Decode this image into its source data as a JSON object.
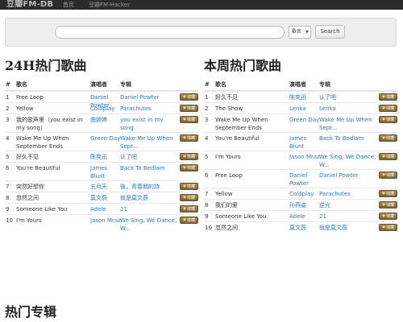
{
  "nav": {
    "brand": "豆瓣FM-DB",
    "links": [
      "首页",
      "豆瓣FM-Hacker"
    ]
  },
  "search": {
    "placeholder": "",
    "select_value": "歌名",
    "button_label": "Search"
  },
  "charts": [
    {
      "title": "24H热门歌曲",
      "headers": [
        "#",
        "歌名",
        "演唱者",
        "专辑"
      ],
      "rows": [
        {
          "num": "1",
          "song": "Free Loop",
          "artist": "Daniel Powter",
          "album": "Daniel Powter"
        },
        {
          "num": "2",
          "song": "Yellow",
          "artist": "Coldplay",
          "album": "Parachutes"
        },
        {
          "num": "3",
          "song": "我的歌声里（you exist in my song）",
          "artist": "曲婉婷",
          "album": "you exist in my song"
        },
        {
          "num": "4",
          "song": "Wake Me Up When September Ends",
          "artist": "Green Day",
          "album": "Wake Me Up When Sept..."
        },
        {
          "num": "5",
          "song": "好久不见",
          "artist": "陈奕迅",
          "album": "认了吧"
        },
        {
          "num": "6",
          "song": "You're Beautiful",
          "artist": "James Blunt",
          "album": "Back To Bedlam"
        },
        {
          "num": "7",
          "song": "突然好想你",
          "artist": "五月天",
          "album": "後。青春期的詩"
        },
        {
          "num": "8",
          "song": "忽然之间",
          "artist": "莫文蔚",
          "album": "就是莫文蔚"
        },
        {
          "num": "9",
          "song": "Someone Like You",
          "artist": "Adele",
          "album": "21"
        },
        {
          "num": "10",
          "song": "I'm Yours",
          "artist": "Jason Mraz",
          "album": "We Sing, We Dance, W..."
        }
      ]
    },
    {
      "title": "本周热门歌曲",
      "headers": [
        "#",
        "歌名",
        "演唱者",
        "专辑"
      ],
      "rows": [
        {
          "num": "1",
          "song": "好久不见",
          "artist": "陈奕迅",
          "album": "认了吧"
        },
        {
          "num": "2",
          "song": "The Show",
          "artist": "Lenka",
          "album": "Lenka"
        },
        {
          "num": "3",
          "song": "Wake Me Up When September Ends",
          "artist": "Green Day",
          "album": "Wake Me Up When Sept..."
        },
        {
          "num": "4",
          "song": "You're Beautiful",
          "artist": "James Blunt",
          "album": "Back To Bedlam"
        },
        {
          "num": "5",
          "song": "I'm Yours",
          "artist": "Jason Mraz",
          "album": "We Sing, We Dance, W..."
        },
        {
          "num": "6",
          "song": "Free Loop",
          "artist": "Daniel Powter",
          "album": "Daniel Powter"
        },
        {
          "num": "7",
          "song": "Yellow",
          "artist": "Coldplay",
          "album": "Parachutes"
        },
        {
          "num": "8",
          "song": "我们的爱",
          "artist": "孙燕姿",
          "album": "逆光"
        },
        {
          "num": "9",
          "song": "Someone Like You",
          "artist": "Adele",
          "album": "21"
        },
        {
          "num": "10",
          "song": "忽然之间",
          "artist": "莫文蔚",
          "album": "就是莫文蔚"
        }
      ]
    }
  ],
  "fav_label": "收藏",
  "albums_title": "热门专辑",
  "colors": {
    "link": "#2a7ab8",
    "topbar": "#2b2b2b",
    "fav": "#8a6e3c"
  }
}
